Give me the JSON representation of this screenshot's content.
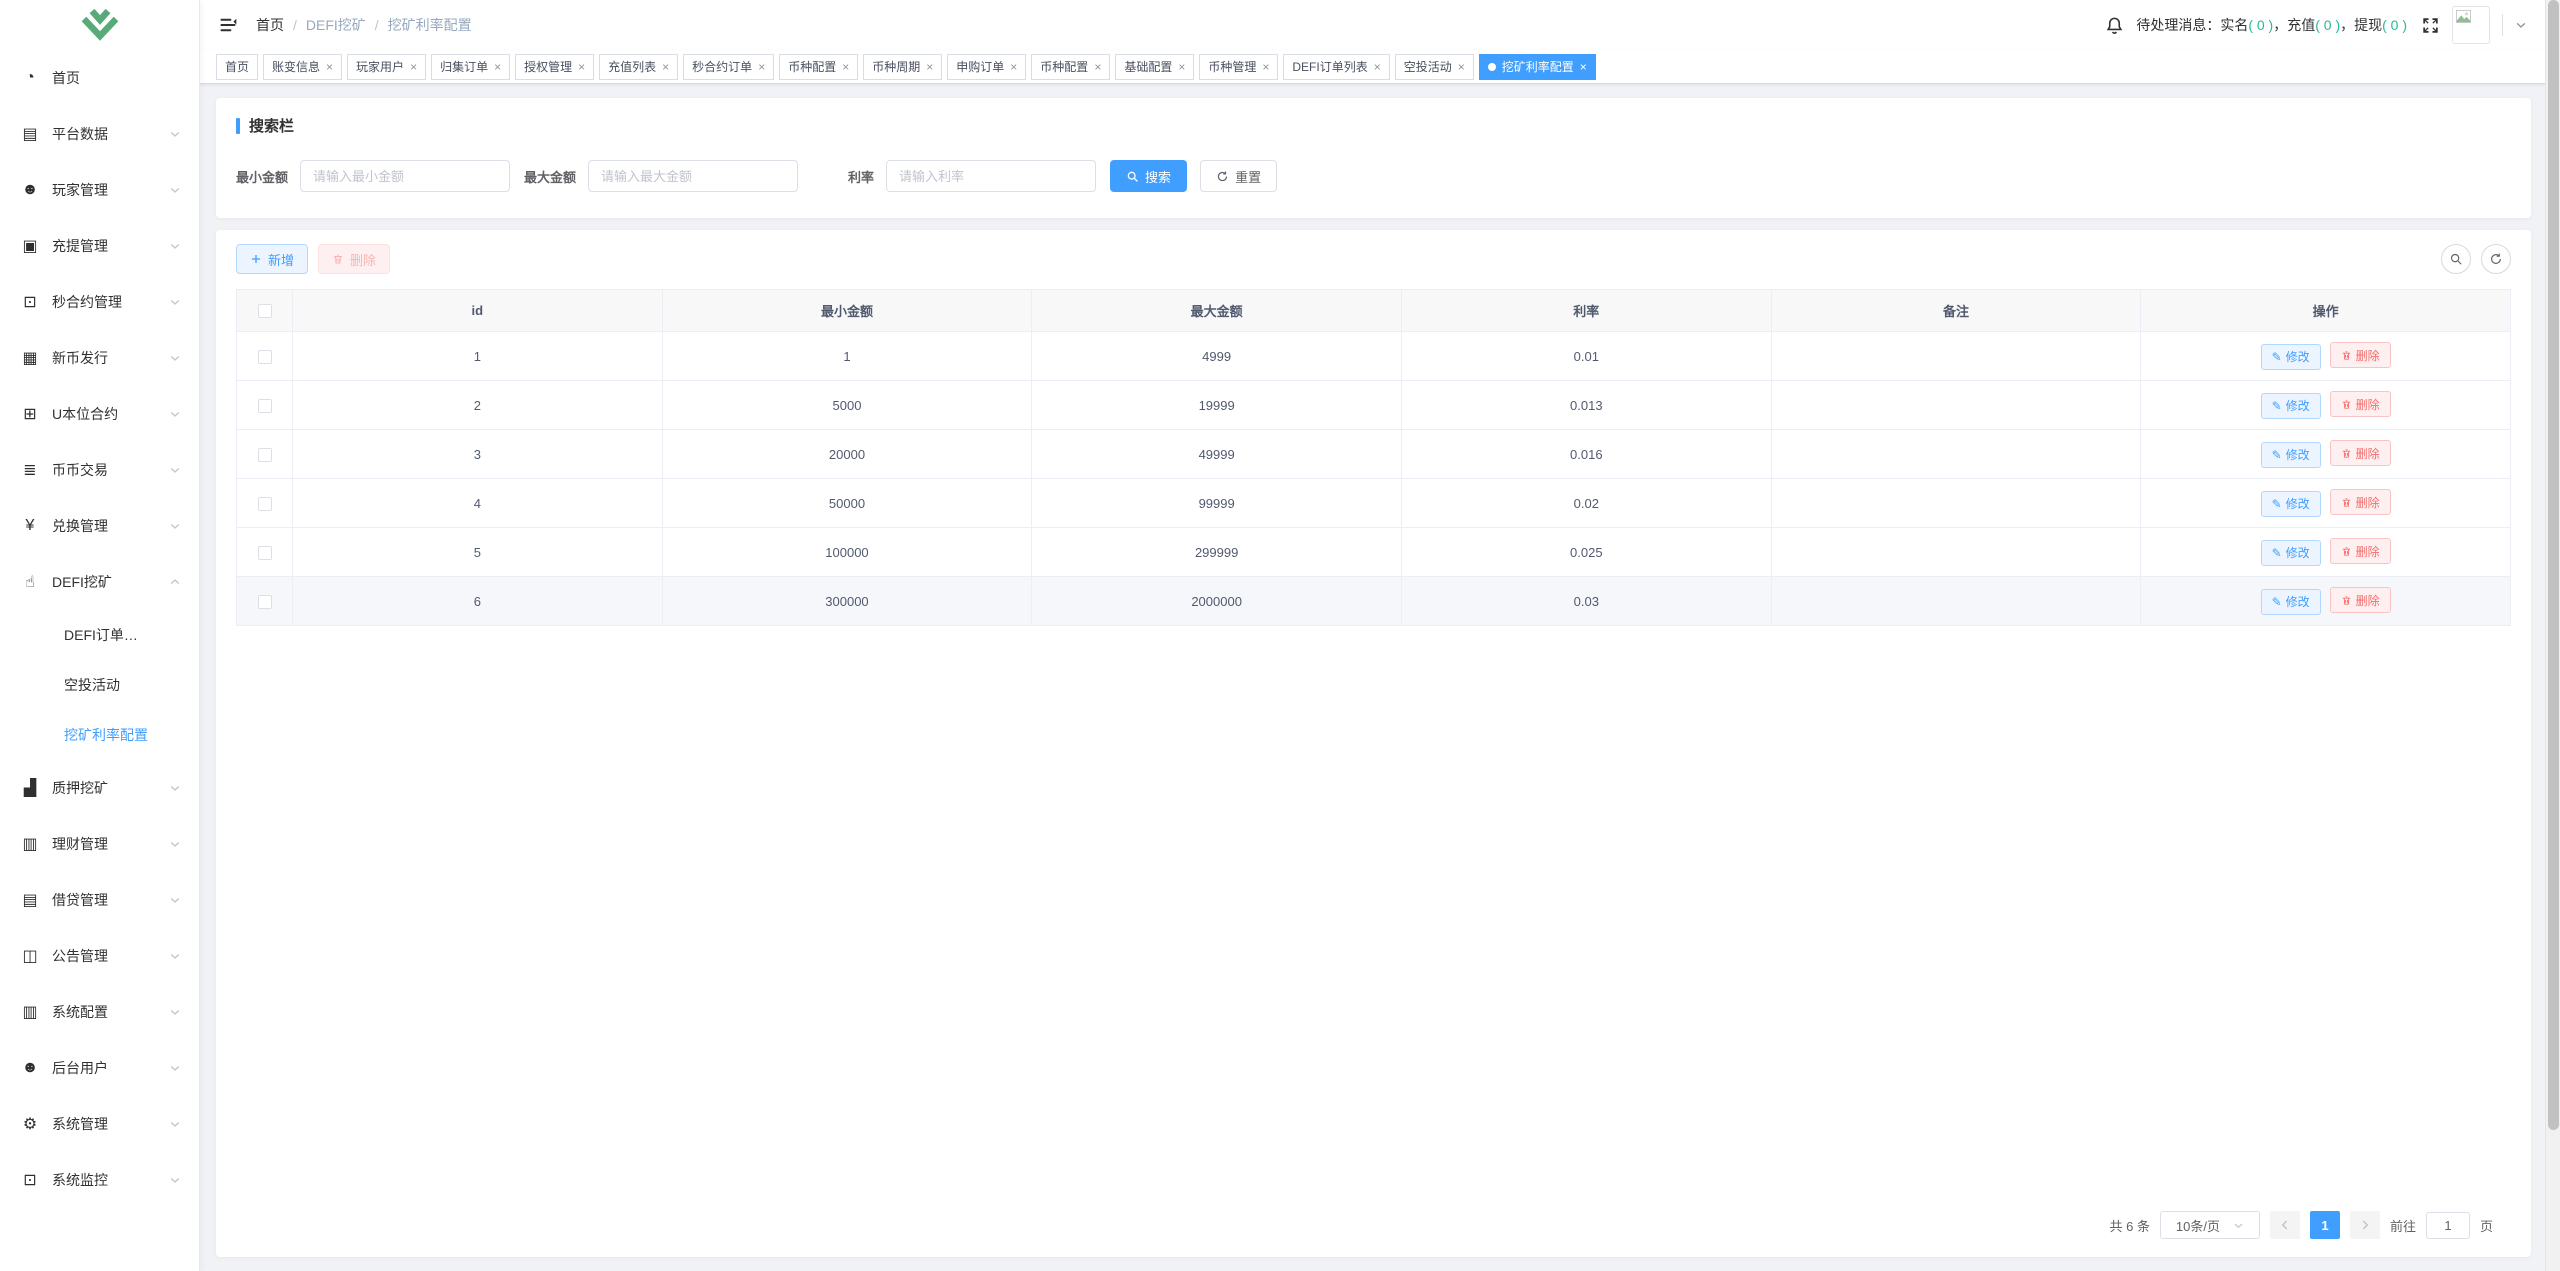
{
  "colors": {
    "accent": "#409eff",
    "count_teal": "#26b99a",
    "danger": "#f56c6c",
    "logo_green": "#57ab78"
  },
  "sidebar": {
    "menu": [
      {
        "name": "home",
        "label": "首页",
        "icon": "dashboard-icon",
        "glyph": "◔"
      },
      {
        "name": "platform-data",
        "label": "平台数据",
        "icon": "excel-icon",
        "glyph": "▤",
        "caret": "down"
      },
      {
        "name": "player-management",
        "label": "玩家管理",
        "icon": "user-icon",
        "glyph": "☻",
        "caret": "down"
      },
      {
        "name": "deposit-withdraw",
        "label": "充提管理",
        "icon": "copy-document-icon",
        "glyph": "▣",
        "caret": "down"
      },
      {
        "name": "second-contract",
        "label": "秒合约管理",
        "icon": "monitor-icon",
        "glyph": "⊡",
        "caret": "down"
      },
      {
        "name": "new-coin-issue",
        "label": "新币发行",
        "icon": "calendar-icon",
        "glyph": "▦",
        "caret": "down"
      },
      {
        "name": "u-contract",
        "label": "U本位合约",
        "icon": "grid-icon",
        "glyph": "⊞",
        "caret": "down"
      },
      {
        "name": "coin-trade",
        "label": "币币交易",
        "icon": "list-icon",
        "glyph": "≣",
        "caret": "down"
      },
      {
        "name": "exchange-management",
        "label": "兑换管理",
        "icon": "yen-icon",
        "glyph": "¥",
        "caret": "down"
      },
      {
        "name": "defi-mining",
        "label": "DEFI挖矿",
        "icon": "finger-icon",
        "glyph": "☝",
        "caret": "up",
        "children": [
          {
            "name": "defi-orders",
            "label": "DEFI订单…",
            "active": false
          },
          {
            "name": "airdrop-activity",
            "label": "空投活动",
            "active": false
          },
          {
            "name": "mining-rate-config",
            "label": "挖矿利率配置",
            "active": true
          }
        ]
      },
      {
        "name": "pledge-mining",
        "label": "质押挖矿",
        "icon": "bar-chart-icon",
        "glyph": "▟",
        "caret": "down"
      },
      {
        "name": "wealth-management",
        "label": "理财管理",
        "icon": "document-icon",
        "glyph": "▥",
        "caret": "down"
      },
      {
        "name": "lending-management",
        "label": "借贷管理",
        "icon": "excel-icon",
        "glyph": "▤",
        "caret": "down"
      },
      {
        "name": "announcement-management",
        "label": "公告管理",
        "icon": "book-icon",
        "glyph": "◫",
        "caret": "down"
      },
      {
        "name": "system-config",
        "label": "系统配置",
        "icon": "document-icon",
        "glyph": "▥",
        "caret": "down"
      },
      {
        "name": "admin-users",
        "label": "后台用户",
        "icon": "people-icon",
        "glyph": "☻",
        "caret": "down"
      },
      {
        "name": "system-management",
        "label": "系统管理",
        "icon": "gear-icon",
        "glyph": "⚙",
        "caret": "down"
      },
      {
        "name": "system-monitor",
        "label": "系统监控",
        "icon": "monitor-icon",
        "glyph": "⊡",
        "caret": "down"
      }
    ]
  },
  "navbar": {
    "breadcrumb": [
      {
        "label": "首页",
        "dim": false
      },
      {
        "label": "DEFI挖矿",
        "dim": true
      },
      {
        "label": "挖矿利率配置",
        "dim": true
      }
    ],
    "notice": {
      "prefix": "待处理消息：",
      "separator": "，",
      "items": [
        {
          "label": "实名",
          "count": "( 0 )"
        },
        {
          "label": "充值",
          "count": "( 0 )"
        },
        {
          "label": "提现",
          "count": "( 0 )"
        }
      ]
    }
  },
  "tabs": {
    "close_glyph": "×",
    "items": [
      {
        "label": "首页",
        "closable": false,
        "active": false
      },
      {
        "label": "账变信息",
        "closable": true,
        "active": false
      },
      {
        "label": "玩家用户",
        "closable": true,
        "active": false
      },
      {
        "label": "归集订单",
        "closable": true,
        "active": false
      },
      {
        "label": "授权管理",
        "closable": true,
        "active": false
      },
      {
        "label": "充值列表",
        "closable": true,
        "active": false
      },
      {
        "label": "秒合约订单",
        "closable": true,
        "active": false
      },
      {
        "label": "币种配置",
        "closable": true,
        "active": false
      },
      {
        "label": "币种周期",
        "closable": true,
        "active": false
      },
      {
        "label": "申购订单",
        "closable": true,
        "active": false
      },
      {
        "label": "币种配置",
        "closable": true,
        "active": false
      },
      {
        "label": "基础配置",
        "closable": true,
        "active": false
      },
      {
        "label": "币种管理",
        "closable": true,
        "active": false
      },
      {
        "label": "DEFI订单列表",
        "closable": true,
        "active": false
      },
      {
        "label": "空投活动",
        "closable": true,
        "active": false
      },
      {
        "label": "挖矿利率配置",
        "closable": true,
        "active": true
      }
    ]
  },
  "search": {
    "title": "搜索栏",
    "fields": [
      {
        "label": "最小金额",
        "placeholder": "请输入最小金额"
      },
      {
        "label": "最大金额",
        "placeholder": "请输入最大金额"
      },
      {
        "label": "利率",
        "placeholder": "请输入利率"
      }
    ],
    "search_label": "搜索",
    "reset_label": "重置"
  },
  "toolbar": {
    "add_label": "新增",
    "delete_label": "删除"
  },
  "table": {
    "columns": [
      "id",
      "最小金额",
      "最大金额",
      "利率",
      "备注",
      "操作"
    ],
    "actions": {
      "edit": "修改",
      "delete": "删除"
    },
    "rows": [
      {
        "id": "1",
        "min": "1",
        "max": "4999",
        "rate": "0.01",
        "note": "",
        "highlighted": false
      },
      {
        "id": "2",
        "min": "5000",
        "max": "19999",
        "rate": "0.013",
        "note": "",
        "highlighted": false
      },
      {
        "id": "3",
        "min": "20000",
        "max": "49999",
        "rate": "0.016",
        "note": "",
        "highlighted": false
      },
      {
        "id": "4",
        "min": "50000",
        "max": "99999",
        "rate": "0.02",
        "note": "",
        "highlighted": false
      },
      {
        "id": "5",
        "min": "100000",
        "max": "299999",
        "rate": "0.025",
        "note": "",
        "highlighted": false
      },
      {
        "id": "6",
        "min": "300000",
        "max": "2000000",
        "rate": "0.03",
        "note": "",
        "highlighted": true
      }
    ]
  },
  "pagination": {
    "total": "共 6 条",
    "page_size": "10条/页",
    "current_page": "1",
    "goto_label": "前往",
    "goto_value": "1",
    "page_unit": "页"
  }
}
